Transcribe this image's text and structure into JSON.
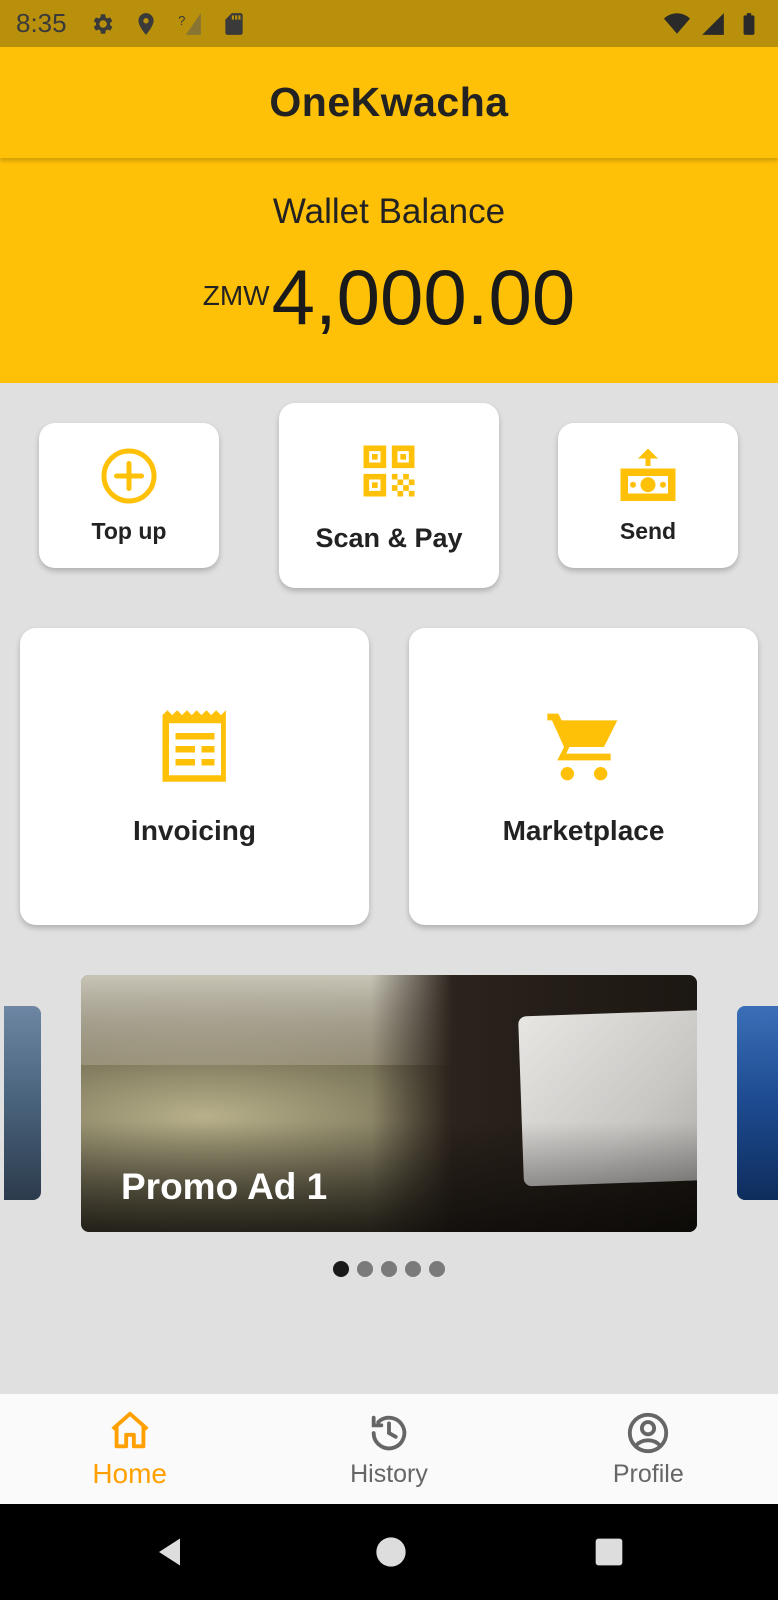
{
  "status_bar": {
    "time": "8:35",
    "left_icons": [
      "gear-icon",
      "location-icon",
      "no-signal-icon",
      "sd-card-icon"
    ],
    "right_icons": [
      "wifi-icon",
      "cell-signal-icon",
      "battery-icon"
    ]
  },
  "app_bar": {
    "title": "OneKwacha"
  },
  "balance": {
    "label": "Wallet Balance",
    "currency": "ZMW",
    "amount": "4,000.00"
  },
  "actions": {
    "top_up": "Top up",
    "scan_pay": "Scan & Pay",
    "send": "Send",
    "invoicing": "Invoicing",
    "marketplace": "Marketplace"
  },
  "carousel": {
    "current_label": "Promo Ad 1",
    "page_count": 5,
    "active_index": 0
  },
  "bottom_nav": {
    "items": [
      {
        "label": "Home",
        "icon": "home-icon",
        "active": true
      },
      {
        "label": "History",
        "icon": "history-icon",
        "active": false
      },
      {
        "label": "Profile",
        "icon": "profile-icon",
        "active": false
      }
    ]
  },
  "colors": {
    "brand": "#FFC107",
    "status_bar": "#B8900B",
    "accent_active": "#FFA000",
    "background": "#E0E0E0"
  }
}
